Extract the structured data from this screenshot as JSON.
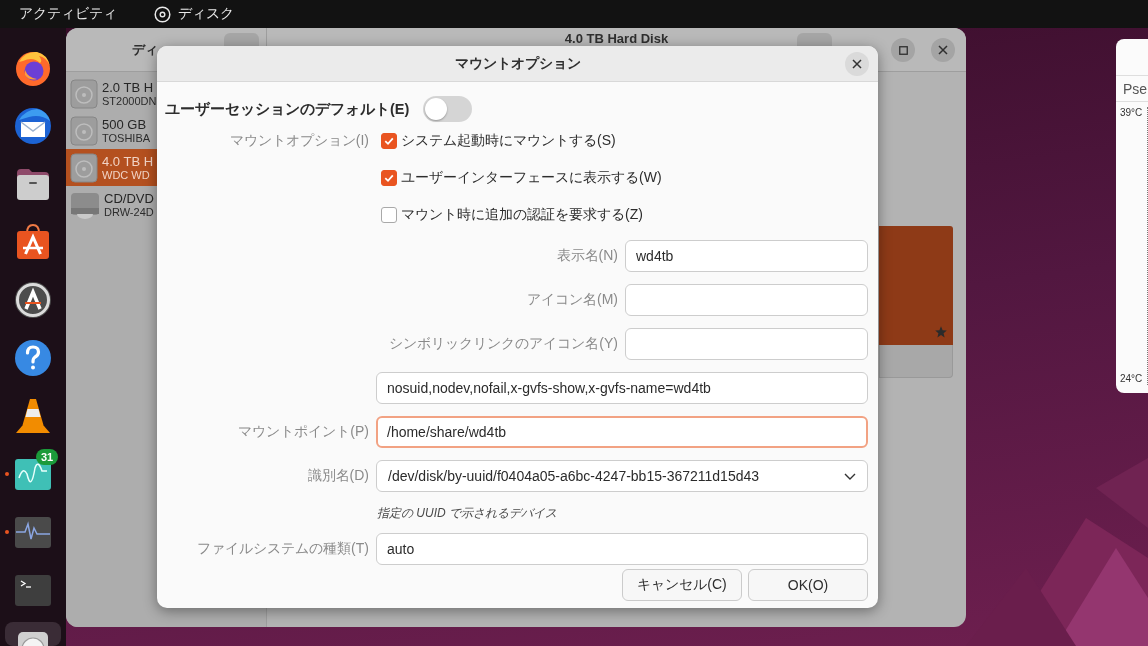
{
  "top_bar": {
    "activities": "アクティビティ",
    "app_name": "ディスク"
  },
  "dock": {
    "items": [
      {
        "kind": "browser",
        "running": false,
        "selected": false
      },
      {
        "kind": "mail",
        "running": false,
        "selected": false
      },
      {
        "kind": "files",
        "running": false,
        "selected": false
      },
      {
        "kind": "store",
        "running": false,
        "selected": false
      },
      {
        "kind": "updater",
        "running": false,
        "selected": false
      },
      {
        "kind": "help",
        "running": false,
        "selected": false
      },
      {
        "kind": "media",
        "running": false,
        "selected": false
      },
      {
        "kind": "monitor",
        "running": true,
        "selected": false,
        "badge": "31"
      },
      {
        "kind": "activity",
        "running": true,
        "selected": false
      },
      {
        "kind": "terminal",
        "running": false,
        "selected": false
      },
      {
        "kind": "disks",
        "running": false,
        "selected": true
      }
    ]
  },
  "disks_window": {
    "sidebar": {
      "title": "ディ",
      "items": [
        {
          "kind": "hdd",
          "name": "2.0 TB H",
          "model": "ST2000DN",
          "selected": false
        },
        {
          "kind": "hdd",
          "name": "500 GB",
          "model": "TOSHIBA",
          "selected": false
        },
        {
          "kind": "hdd",
          "name": "4.0 TB H",
          "model": "WDC WD",
          "selected": true
        },
        {
          "kind": "optical",
          "name": "CD/DVD",
          "model": "DRW-24D",
          "selected": false
        }
      ]
    },
    "title": "4.0 TB Hard Disk"
  },
  "mount_dialog": {
    "title": "マウントオプション",
    "user_session_defaults": {
      "label": "ユーザーセッションのデフォルト(E)",
      "on": false
    },
    "mount_options_label": "マウントオプション(I)",
    "checkboxes": [
      {
        "label": "システム起動時にマウントする(S)",
        "checked": true
      },
      {
        "label": "ユーザーインターフェースに表示する(W)",
        "checked": true
      },
      {
        "label": "マウント時に追加の認証を要求する(Z)",
        "checked": false
      }
    ],
    "name_fields": [
      {
        "label": "表示名(N)",
        "value": "wd4tb"
      },
      {
        "label": "アイコン名(M)"
      },
      {
        "label": "シンボリックリンクのアイコン名(Y)"
      }
    ],
    "options_value": "nosuid,nodev,nofail,x-gvfs-show,x-gvfs-name=wd4tb",
    "mount_point": {
      "label": "マウントポイント(P)",
      "value": "/home/share/wd4tb",
      "focused": true
    },
    "identify_as": {
      "label": "識別名(D)",
      "value": "/dev/disk/by-uuid/f0404a05-a6bc-4247-bb15-367211d15d43"
    },
    "identify_hint": "指定の UUID で示されるデバイス",
    "filesystem_type": {
      "label": "ファイルシステムの種類(T)",
      "value": "auto"
    },
    "buttons": [
      {
        "label": "キャンセル(C)"
      },
      {
        "label": "OK(O)"
      }
    ]
  },
  "side_window": {
    "tab": "Pse",
    "axis_labels": [
      "39°C",
      "24°C"
    ]
  }
}
